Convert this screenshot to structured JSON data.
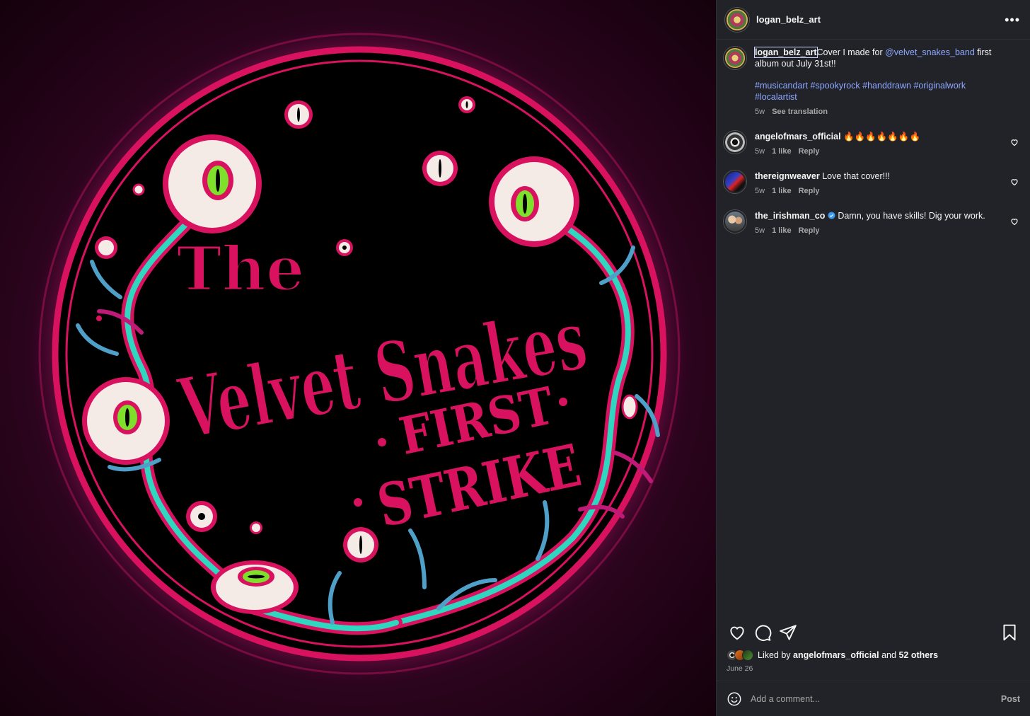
{
  "post": {
    "author": "logan_belz_art",
    "caption_text": "Cover I made for",
    "caption_mention": "@velvet_snakes_band",
    "caption_after": "first album out July 31st!!",
    "hashtags": "#musicandart #spookyrock #handdrawn #originalwork #localartist",
    "time": "5w",
    "see_translation": "See translation",
    "more_icon": "more-horizontal-icon"
  },
  "artwork": {
    "line1": "The",
    "line2": "Velvet Snakes",
    "line3": "FIRST",
    "line4": "STRIKE",
    "colors": {
      "background": "#3a0628",
      "ring": "#d8125f",
      "text": "#d8125f",
      "vine": "#2fd6c0",
      "eye": "#7ee02a"
    }
  },
  "comments": [
    {
      "username": "angelofmars_official",
      "text": "🔥🔥🔥🔥🔥🔥🔥",
      "time": "5w",
      "likes": "1 like",
      "reply": "Reply"
    },
    {
      "username": "thereignweaver",
      "text": "Love that cover!!!",
      "time": "5w",
      "likes": "1 like",
      "reply": "Reply"
    },
    {
      "username": "the_irishman_co",
      "text": "Damn, you have skills! Dig your work.",
      "time": "5w",
      "likes": "1 like",
      "reply": "Reply",
      "verified": true
    }
  ],
  "actions": {
    "like_icon": "heart-icon",
    "comment_icon": "comment-icon",
    "share_icon": "send-icon",
    "save_icon": "bookmark-icon"
  },
  "likes": {
    "prefix": "Liked by",
    "user": "angelofmars_official",
    "and": "and",
    "others": "52 others"
  },
  "date": "June 26",
  "add_comment": {
    "placeholder": "Add a comment...",
    "post_label": "Post"
  }
}
